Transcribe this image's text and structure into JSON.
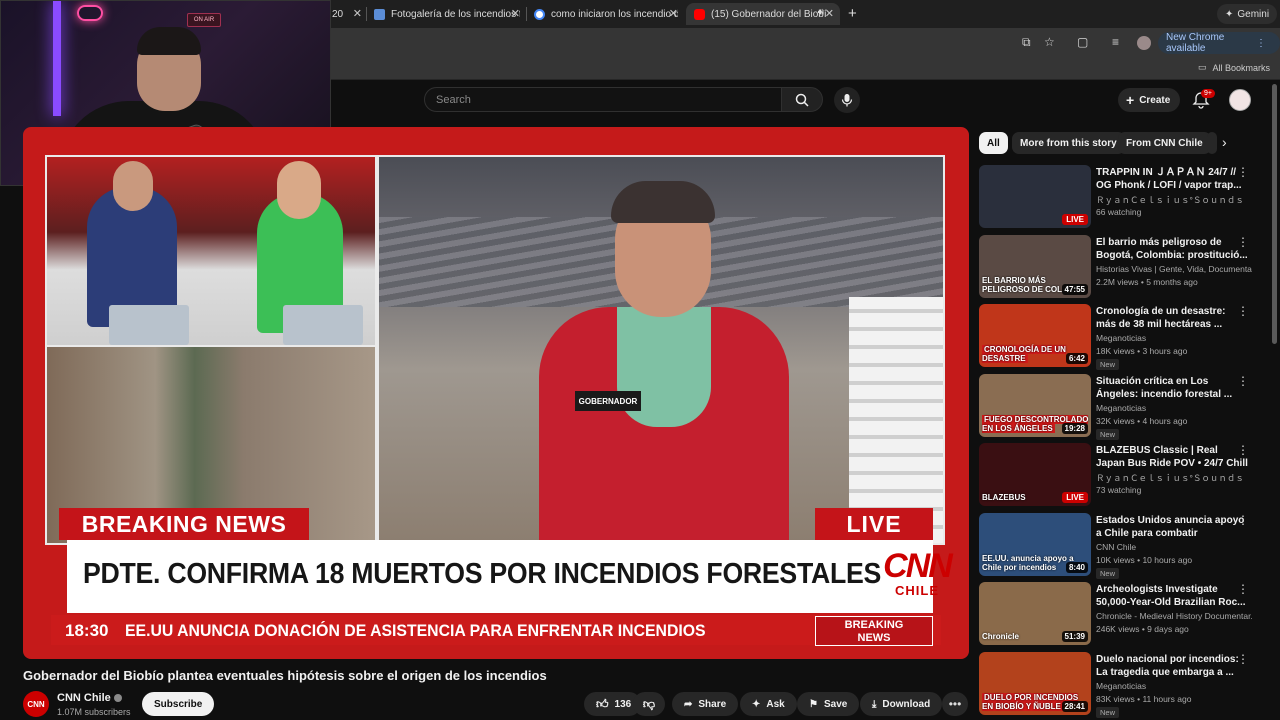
{
  "browser": {
    "tabs": [
      {
        "label": "20",
        "favicon_color": "#666666"
      },
      {
        "label": "Fotogalería de los incendios f",
        "favicon_color": "#5b8dd6"
      },
      {
        "label": "como iniciaron los incendio d",
        "favicon_color": "#4285f4"
      },
      {
        "label": "(15) Gobernador del Biobí",
        "favicon_color": "#ff0000"
      }
    ],
    "new_tab": "+",
    "gemini_label": "Gemini",
    "new_chrome_label": "New Chrome available",
    "all_bookmarks": "All Bookmarks"
  },
  "youtube_header": {
    "search_placeholder": "Search",
    "create_label": "Create",
    "notification_count": "9+"
  },
  "webcam": {
    "sign_text": "ON AIR"
  },
  "player": {
    "graphics": {
      "breaking_news": "BREAKING NEWS",
      "live": "LIVE",
      "headline": "PDTE. CONFIRMA 18 MUERTOS POR INCENDIOS FORESTALES",
      "logo_big": "CNN",
      "logo_small": "CHILE",
      "ticker_time": "18:30",
      "ticker_text": "EE.UU ANUNCIA DONACIÓN DE ASISTENCIA PARA ENFRENTAR INCENDIOS",
      "bn_box_line1": "BREAKING",
      "bn_box_line2": "NEWS",
      "vest_tag": "GOBERNADOR"
    }
  },
  "video": {
    "title": "Gobernador del Biobío plantea eventuales hipótesis sobre el origen de los incendios",
    "channel": "CNN Chile",
    "channel_logo": "CNN",
    "subscribers": "1.07M subscribers",
    "subscribe_label": "Subscribe",
    "actions": {
      "likes": "136",
      "share": "Share",
      "ask": "Ask",
      "save": "Save",
      "download": "Download"
    }
  },
  "sidebar": {
    "chips": [
      "All",
      "More from this story",
      "From CNN Chile"
    ],
    "recommendations": [
      {
        "title": "TRAPPIN IN ＪＡＰＡＮ 24/7 // OG Phonk / LOFI / vapor trap...",
        "channel": "ＲｙａｎＣｅｌｓｉｕｓ°Ｓｏｕｎｄｓ",
        "meta": "66 watching",
        "badge": "LIVE",
        "thumb_color": "#2a2f3c",
        "thumb_text": "",
        "new": ""
      },
      {
        "title": "El barrio más peligroso de Bogotá, Colombia: prostitució...",
        "channel": "Historias Vivas | Gente, Vida, Documenta...",
        "meta": "2.2M views • 5 months ago",
        "badge": "47:55",
        "thumb_color": "#5a4a44",
        "thumb_text": "EL BARRIO MÁS PELIGROSO DE COL",
        "new": ""
      },
      {
        "title": "Cronología de un desastre: más de 38 mil hectáreas ...",
        "channel": "Meganoticias",
        "meta": "18K views • 3 hours ago",
        "badge": "6:42",
        "thumb_color": "#c0361a",
        "thumb_text": "CRONOLOGÍA DE UN DESASTRE",
        "new": "New"
      },
      {
        "title": "Situación crítica en Los Ángeles: incendio forestal ...",
        "channel": "Meganoticias",
        "meta": "32K views • 4 hours ago",
        "badge": "19:28",
        "thumb_color": "#8a6d52",
        "thumb_text": "FUEGO DESCONTROLADO EN LOS ÁNGELES",
        "new": "New"
      },
      {
        "title": "BLAZEBUS Classic | Real Japan Bus Ride POV • 24/7 Chill 201...",
        "channel": "ＲｙａｎＣｅｌｓｉｕｓ°Ｓｏｕｎｄｓ",
        "meta": "73 watching",
        "badge": "LIVE",
        "thumb_color": "#3a0f12",
        "thumb_text": "BLAZEBUS",
        "new": ""
      },
      {
        "title": "Estados Unidos anuncia apoyo a Chile para combatir incendio...",
        "channel": "CNN Chile",
        "meta": "10K views • 10 hours ago",
        "badge": "8:40",
        "thumb_color": "#2d4e7a",
        "thumb_text": "EE.UU. anuncia apoyo a Chile por incendios",
        "new": "New"
      },
      {
        "title": "Archeologists Investigate 50,000-Year-Old Brazilian Roc...",
        "channel": "Chronicle - Medieval History Documentar...",
        "meta": "246K views • 9 days ago",
        "badge": "51:39",
        "thumb_color": "#8a6a4a",
        "thumb_text": "Chronicle",
        "new": ""
      },
      {
        "title": "Duelo nacional por incendios: La tragedia que embarga a ...",
        "channel": "Meganoticias",
        "meta": "83K views • 11 hours ago",
        "badge": "28:41",
        "thumb_color": "#b3421c",
        "thumb_text": "DUELO POR INCENDIOS EN BIOBÍO Y ÑUBLE",
        "new": "New"
      }
    ]
  }
}
